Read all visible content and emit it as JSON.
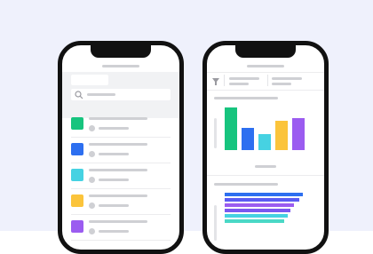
{
  "colors": {
    "background": "#eff1fc",
    "bezel": "#111111",
    "placeholder": "#cfd0d4",
    "search_bar": "#e8e9ec"
  },
  "left_phone": {
    "search": {
      "icon": "search-icon"
    },
    "items": [
      {
        "color": "#17c47e"
      },
      {
        "color": "#2d6ff0"
      },
      {
        "color": "#46d2e2"
      },
      {
        "color": "#fbc43b"
      },
      {
        "color": "#9b5cf0"
      }
    ]
  },
  "right_phone": {
    "filter": {
      "icon": "filter-icon"
    },
    "bar_chart": {
      "type": "bar",
      "values": [
        48,
        25,
        18,
        33,
        36
      ],
      "colors": [
        "#17c47e",
        "#2d6ff0",
        "#46d2e2",
        "#fbc43b",
        "#9b5cf0"
      ]
    },
    "hbar_chart": {
      "type": "bar",
      "values": [
        88,
        84,
        78,
        74,
        71,
        67
      ],
      "colors": [
        "#2d6ff0",
        "#5b5bf2",
        "#9b5cf0",
        "#7a58f0",
        "#46d2e2",
        "#4ad8c6"
      ]
    }
  }
}
